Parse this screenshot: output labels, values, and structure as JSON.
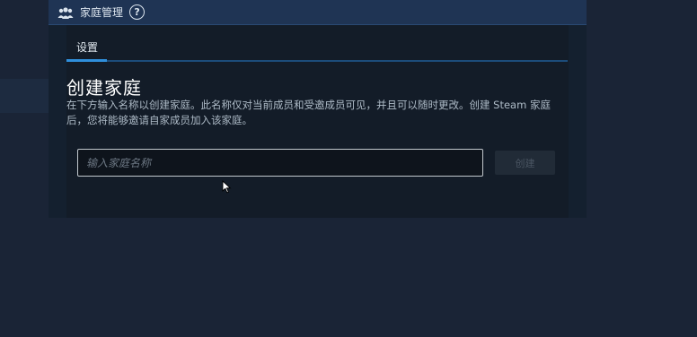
{
  "header": {
    "icon": "family-icon",
    "title": "家庭管理",
    "help_icon": "help-icon",
    "help_glyph": "?"
  },
  "tabs": [
    {
      "label": "设置",
      "active": true
    }
  ],
  "main": {
    "title": "创建家庭",
    "description": "在下方输入名称以创建家庭。此名称仅对当前成员和受邀成员可见，并且可以随时更改。创建 Steam 家庭后，您将能够邀请自家成员加入该家庭。"
  },
  "form": {
    "name_input_value": "",
    "name_input_placeholder": "输入家庭名称",
    "create_button_label": "创建",
    "create_button_enabled": false
  },
  "colors": {
    "page_bg": "#1a2436",
    "header_bg": "#1f3454",
    "tab_accent": "#2f8fdc",
    "panel_bg": "#131c28"
  }
}
